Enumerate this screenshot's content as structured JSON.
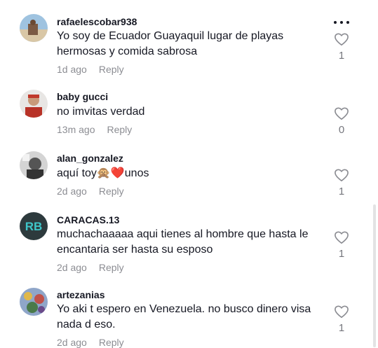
{
  "comments": [
    {
      "username": "rafaelescobar938",
      "text": "Yo soy de Ecuador Guayaquil lugar de playas hermosas y comida sabrosa",
      "time": "1d ago",
      "reply": "Reply",
      "likes": "1"
    },
    {
      "username": "baby gucci",
      "text": "no imvitas verdad",
      "time": "13m ago",
      "reply": "Reply",
      "likes": "0"
    },
    {
      "username": "alan_gonzalez",
      "text": "aquí toy🙊❤️unos",
      "time": "2d ago",
      "reply": "Reply",
      "likes": "1"
    },
    {
      "username": "CARACAS.13",
      "text": "muchachaaaaa aqui tienes al hombre que hasta le encantaria ser hasta su esposo",
      "time": "2d ago",
      "reply": "Reply",
      "likes": "1"
    },
    {
      "username": "artezanias",
      "text": "Yo aki t espero en Venezuela. no busco dinero visa nada d eso.",
      "time": "2d ago",
      "reply": "Reply",
      "likes": "1"
    }
  ],
  "avatars": {
    "rb_logo_text": "RB",
    "rb_bg": "#2d3a3d",
    "rb_accent": "#3ec6c9"
  },
  "icons": {
    "like": "heart-outline-icon",
    "more": "more-dots-icon"
  }
}
